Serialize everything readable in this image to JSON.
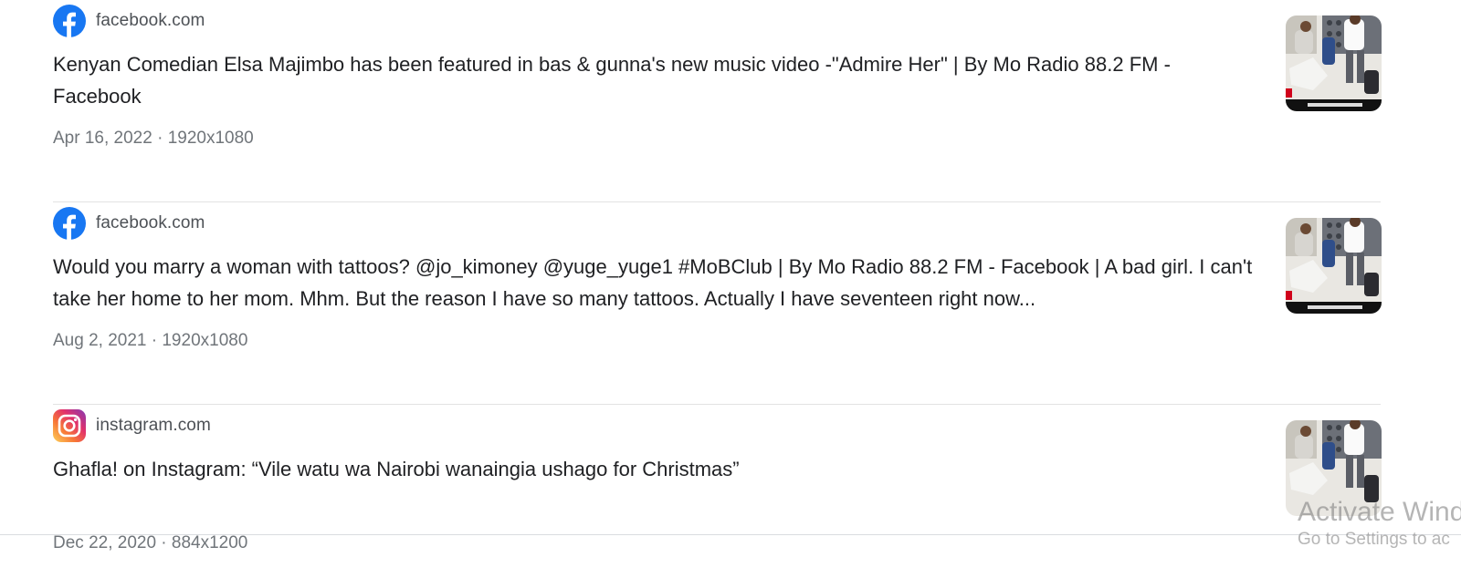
{
  "results": [
    {
      "favicon": "facebook-icon",
      "site": "facebook.com",
      "title": "Kenyan Comedian Elsa Majimbo has been featured in bas & gunna's new music video -\"Admire Her\" | By Mo Radio 88.2 FM - Facebook",
      "meta": "Apr 16, 2022 · 1920x1080"
    },
    {
      "favicon": "facebook-icon",
      "site": "facebook.com",
      "title": "Would you marry a woman with tattoos? @jo_kimoney @yuge_yuge1 #MoBClub | By Mo Radio 88.2 FM - Facebook | A bad girl. I can't take her home to her mom. Mhm. But the reason I have so many tattoos. Actually I have seventeen right now...",
      "meta": "Aug 2, 2021 · 1920x1080"
    },
    {
      "favicon": "instagram-icon",
      "site": "instagram.com",
      "title": "Ghafla! on Instagram: “Vile watu wa Nairobi wanaingia ushago for Christmas”",
      "meta": "Dec 22, 2020 · 884x1200"
    }
  ],
  "watermark": {
    "line1": "Activate Wind",
    "line2": "Go to Settings to ac"
  },
  "colors": {
    "facebook": "#1877f2",
    "title_text": "#202124",
    "meta_text": "#70757a",
    "divider": "#e3e3e3"
  }
}
